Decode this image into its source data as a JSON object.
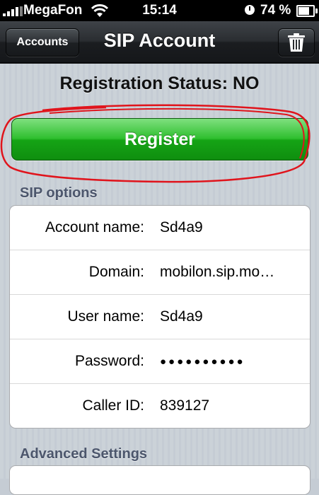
{
  "statusbar": {
    "carrier": "MegaFon",
    "time": "15:14",
    "battery": "74 %"
  },
  "navbar": {
    "back_label": "Accounts",
    "title": "SIP Account",
    "trash_icon": "trash-icon"
  },
  "registration_status": "Registration Status: NO",
  "register_button": "Register",
  "sip_options": {
    "header": "SIP options",
    "rows": [
      {
        "label": "Account name:",
        "value": "Sd4a9"
      },
      {
        "label": "Domain:",
        "value": "mobilon.sip.mo…"
      },
      {
        "label": "User name:",
        "value": "Sd4a9"
      },
      {
        "label": "Password:",
        "value": "●●●●●●●●●●"
      },
      {
        "label": "Caller ID:",
        "value": "839127"
      }
    ]
  },
  "advanced": {
    "header": "Advanced Settings"
  },
  "colors": {
    "register_green": "#15a415",
    "annotation_red": "#e0141c",
    "section_header": "#4c566c"
  }
}
